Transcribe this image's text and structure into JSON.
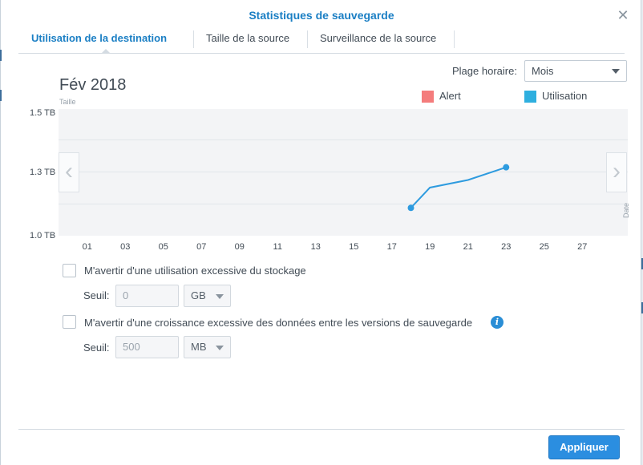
{
  "window": {
    "title": "Statistiques de sauvegarde",
    "close_icon": "close-icon"
  },
  "tabs": [
    {
      "label": "Utilisation de la destination",
      "active": true
    },
    {
      "label": "Taille de la source",
      "active": false
    },
    {
      "label": "Surveillance de la source",
      "active": false
    }
  ],
  "time_range": {
    "label": "Plage horaire:",
    "value": "Mois"
  },
  "period": {
    "title": "Fév 2018",
    "size_caption": "Taille",
    "date_caption": "Date"
  },
  "legend": [
    {
      "label": "Alert",
      "color": "#f47c7c"
    },
    {
      "label": "Utilisation",
      "color": "#2eafdf"
    }
  ],
  "chart_data": {
    "type": "line",
    "title": "Fév 2018",
    "xlabel": "Date",
    "ylabel": "Taille",
    "y_tick_labels": [
      "1.5 TB",
      "1.3 TB",
      "1.0 TB"
    ],
    "x_tick_labels": [
      "01",
      "03",
      "05",
      "07",
      "09",
      "11",
      "13",
      "15",
      "17",
      "19",
      "21",
      "23",
      "25",
      "27"
    ],
    "xlim": [
      0,
      28.5
    ],
    "ylim": [
      1.0,
      1.5
    ],
    "grid": true,
    "legend_position": "top-right",
    "series": [
      {
        "name": "Alert",
        "color": "#f47c7c",
        "x": [],
        "y": []
      },
      {
        "name": "Utilisation",
        "color": "#2e9bdf",
        "x": [
          18,
          19,
          21,
          23
        ],
        "y": [
          1.11,
          1.19,
          1.22,
          1.27
        ]
      }
    ]
  },
  "alerts": [
    {
      "label": "M'avertir d'une utilisation excessive du stockage",
      "checked": false,
      "threshold_label": "Seuil:",
      "threshold_placeholder": "0",
      "unit": "GB"
    },
    {
      "label": "M'avertir d'une croissance excessive des données entre les versions de sauvegarde",
      "checked": false,
      "threshold_label": "Seuil:",
      "threshold_placeholder": "500",
      "unit": "MB"
    }
  ],
  "footer": {
    "apply_label": "Appliquer"
  }
}
